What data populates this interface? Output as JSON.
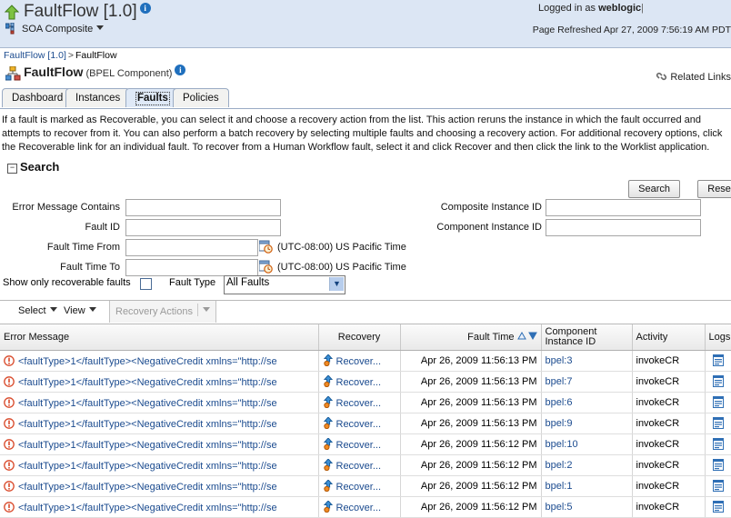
{
  "header": {
    "app_title": "FaultFlow [1.0]",
    "info_icon": "info-icon",
    "up_icon": "up-arrow-icon",
    "composite_label": "SOA Composite",
    "composite_icon": "soa-composite-icon",
    "logged_in_prefix": "Logged in as",
    "logged_in_user": "weblogic",
    "page_refreshed": "Page Refreshed Apr 27, 2009 7:56:19 AM PDT"
  },
  "breadcrumb": {
    "root": "FaultFlow [1.0]",
    "separator": ">",
    "current": "FaultFlow"
  },
  "component": {
    "icon": "bpel-component-icon",
    "name": "FaultFlow",
    "type": "(BPEL Component)",
    "info_icon": "info-icon",
    "related_links": "Related Links",
    "related_links_icon": "chain-link-icon"
  },
  "tabs": [
    {
      "label": "Dashboard",
      "selected": false
    },
    {
      "label": "Instances",
      "selected": false
    },
    {
      "label": "Faults",
      "selected": true
    },
    {
      "label": "Policies",
      "selected": false
    }
  ],
  "intro": "If a fault is marked as Recoverable, you can select it and choose a recovery action from the list. This action reruns the instance in which the fault occurred and attempts to recover from it. You can also perform a batch recovery by selecting multiple faults and choosing a recovery action. For additional recovery options, click the Recoverable link for an individual fault. To recover from a Human Workflow fault, select it and click Recover and then click the link to the Worklist application.",
  "search": {
    "title": "Search",
    "twisty": "−",
    "fields": {
      "error_message_label": "Error Message Contains",
      "error_message_value": "",
      "fault_id_label": "Fault ID",
      "fault_id_value": "",
      "fault_time_from_label": "Fault Time From",
      "fault_time_from_value": "",
      "fault_time_to_label": "Fault Time To",
      "fault_time_to_value": "",
      "composite_instance_id_label": "Composite Instance ID",
      "composite_instance_id_value": "",
      "component_instance_id_label": "Component Instance ID",
      "component_instance_id_value": ""
    },
    "timezone_from": "(UTC-08:00) US Pacific Time",
    "timezone_to": "(UTC-08:00) US Pacific Time",
    "calendar_icon": "calendar-clock-icon",
    "search_button": "Search",
    "reset_button": "Reset"
  },
  "filters": {
    "recoverable_label": "Show only recoverable faults",
    "recoverable_checked": false,
    "fault_type_label": "Fault Type",
    "fault_type_value": "All Faults",
    "fault_type_options": [
      "All Faults"
    ]
  },
  "toolbar": {
    "select_label": "Select",
    "view_label": "View",
    "recovery_actions_label": "Recovery Actions",
    "recovery_actions_disabled": true
  },
  "table": {
    "columns": [
      {
        "key": "error",
        "label": "Error Message"
      },
      {
        "key": "recovery",
        "label": "Recovery"
      },
      {
        "key": "time",
        "label": "Fault Time",
        "sortable": true,
        "sort_icons": "sort-asc-desc-icon"
      },
      {
        "key": "cid",
        "label_line1": "Component",
        "label_line2": "Instance ID"
      },
      {
        "key": "activity",
        "label": "Activity"
      },
      {
        "key": "logs",
        "label": "Logs"
      }
    ],
    "rows": [
      {
        "status_icon": "error-icon",
        "error": "<faultType>1</faultType><NegativeCredit xmlns=\"http://se",
        "recovery": "Recover...",
        "recovery_icon": "recover-icon",
        "time": "Apr 26, 2009 11:56:13 PM",
        "cid": "bpel:3",
        "activity": "invokeCR",
        "log_icon": "log-icon"
      },
      {
        "status_icon": "error-icon",
        "error": "<faultType>1</faultType><NegativeCredit xmlns=\"http://se",
        "recovery": "Recover...",
        "recovery_icon": "recover-icon",
        "time": "Apr 26, 2009 11:56:13 PM",
        "cid": "bpel:7",
        "activity": "invokeCR",
        "log_icon": "log-icon"
      },
      {
        "status_icon": "error-icon",
        "error": "<faultType>1</faultType><NegativeCredit xmlns=\"http://se",
        "recovery": "Recover...",
        "recovery_icon": "recover-icon",
        "time": "Apr 26, 2009 11:56:13 PM",
        "cid": "bpel:6",
        "activity": "invokeCR",
        "log_icon": "log-icon"
      },
      {
        "status_icon": "error-icon",
        "error": "<faultType>1</faultType><NegativeCredit xmlns=\"http://se",
        "recovery": "Recover...",
        "recovery_icon": "recover-icon",
        "time": "Apr 26, 2009 11:56:13 PM",
        "cid": "bpel:9",
        "activity": "invokeCR",
        "log_icon": "log-icon"
      },
      {
        "status_icon": "error-icon",
        "error": "<faultType>1</faultType><NegativeCredit xmlns=\"http://se",
        "recovery": "Recover...",
        "recovery_icon": "recover-icon",
        "time": "Apr 26, 2009 11:56:12 PM",
        "cid": "bpel:10",
        "activity": "invokeCR",
        "log_icon": "log-icon"
      },
      {
        "status_icon": "error-icon",
        "error": "<faultType>1</faultType><NegativeCredit xmlns=\"http://se",
        "recovery": "Recover...",
        "recovery_icon": "recover-icon",
        "time": "Apr 26, 2009 11:56:12 PM",
        "cid": "bpel:2",
        "activity": "invokeCR",
        "log_icon": "log-icon"
      },
      {
        "status_icon": "error-icon",
        "error": "<faultType>1</faultType><NegativeCredit xmlns=\"http://se",
        "recovery": "Recover...",
        "recovery_icon": "recover-icon",
        "time": "Apr 26, 2009 11:56:12 PM",
        "cid": "bpel:1",
        "activity": "invokeCR",
        "log_icon": "log-icon"
      },
      {
        "status_icon": "error-icon",
        "error": "<faultType>1</faultType><NegativeCredit xmlns=\"http://se",
        "recovery": "Recover...",
        "recovery_icon": "recover-icon",
        "time": "Apr 26, 2009 11:56:12 PM",
        "cid": "bpel:5",
        "activity": "invokeCR",
        "log_icon": "log-icon"
      }
    ]
  },
  "colors": {
    "band": "#dce6f4",
    "link": "#1b4b8f",
    "tab_selected": "#dfe9f7",
    "error": "#d94a2b"
  }
}
